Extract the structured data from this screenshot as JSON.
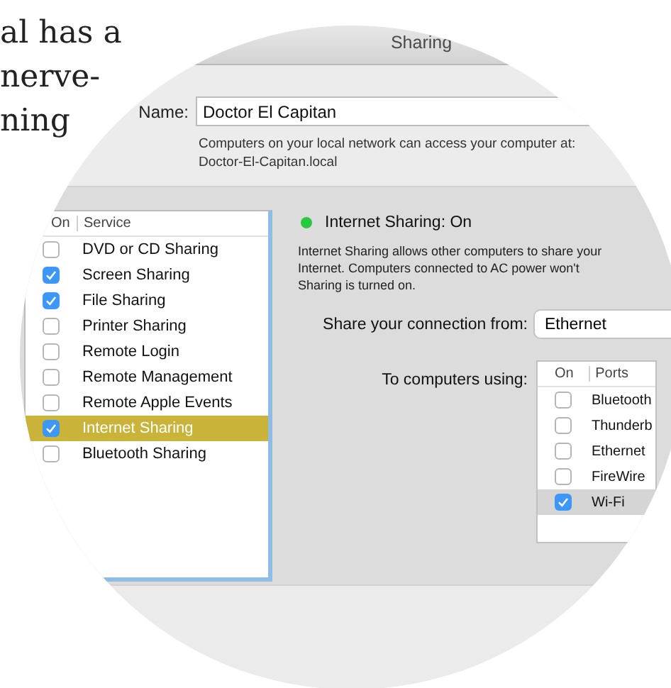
{
  "article": {
    "lines": [
      "al has a",
      "nerve-",
      "ning"
    ]
  },
  "window": {
    "title": "Sharing"
  },
  "computer_name": {
    "label": "Name:",
    "value": "Doctor El Capitan",
    "hint": [
      "Computers on your local network can access your computer at:",
      "Doctor-El-Capitan.local"
    ]
  },
  "services": {
    "columns": [
      "On",
      "Service"
    ],
    "rows": [
      {
        "name": "DVD or CD Sharing",
        "checked": false,
        "selected": false
      },
      {
        "name": "Screen Sharing",
        "checked": true,
        "selected": false
      },
      {
        "name": "File Sharing",
        "checked": true,
        "selected": false
      },
      {
        "name": "Printer Sharing",
        "checked": false,
        "selected": false
      },
      {
        "name": "Remote Login",
        "checked": false,
        "selected": false
      },
      {
        "name": "Remote Management",
        "checked": false,
        "selected": false
      },
      {
        "name": "Remote Apple Events",
        "checked": false,
        "selected": false
      },
      {
        "name": "Internet Sharing",
        "checked": true,
        "selected": true
      },
      {
        "name": "Bluetooth Sharing",
        "checked": false,
        "selected": false
      }
    ]
  },
  "detail": {
    "status": "Internet Sharing: On",
    "on": true,
    "description": [
      "Internet Sharing allows other computers to share your",
      "Internet. Computers connected to AC power won't",
      "Sharing is turned on."
    ],
    "share_from": {
      "label": "Share your connection from:",
      "value": "Ethernet"
    },
    "to_computers": {
      "label": "To computers using:",
      "columns": [
        "On",
        "Ports"
      ],
      "rows": [
        {
          "name": "Bluetooth",
          "checked": false,
          "selected": false
        },
        {
          "name": "Thunderb",
          "checked": false,
          "selected": false
        },
        {
          "name": "Ethernet",
          "checked": false,
          "selected": false
        },
        {
          "name": "FireWire",
          "checked": false,
          "selected": false
        },
        {
          "name": "Wi-Fi",
          "checked": true,
          "selected": true
        }
      ]
    }
  }
}
